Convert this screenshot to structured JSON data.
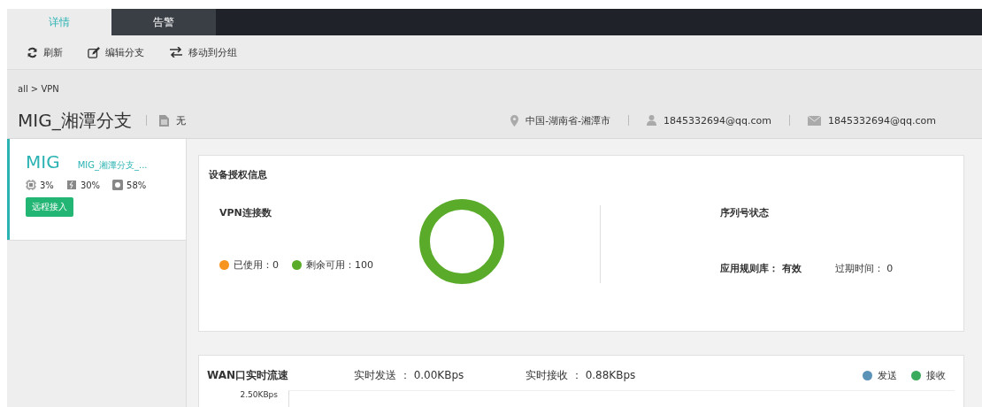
{
  "tabs": [
    {
      "label": "详情",
      "selected": true
    },
    {
      "label": "告警",
      "selected": false
    }
  ],
  "toolbar": [
    {
      "kind": "refresh",
      "label": "刷新"
    },
    {
      "kind": "edit",
      "label": "编辑分支"
    },
    {
      "kind": "move",
      "label": "移动到分组"
    }
  ],
  "breadcrumb": "all > VPN",
  "header": {
    "title": "MIG_湘潭分支",
    "note": "无",
    "location": "中国-湖南省-湘潭市",
    "user": "1845332694@qq.com",
    "email": "1845332694@qq.com"
  },
  "device": {
    "model": "MIG",
    "name": "MIG_湘潭分支_...",
    "stats": [
      {
        "kind": "cpu",
        "value": "3%"
      },
      {
        "kind": "memory",
        "value": "30%"
      },
      {
        "kind": "disk",
        "value": "58%"
      }
    ],
    "button": "远程接入"
  },
  "license": {
    "title": "设备授权信息",
    "vpn_title": "VPN连接数",
    "legend": [
      {
        "label": "已使用：",
        "value": "0",
        "color": "#f7941d"
      },
      {
        "label": "剩余可用：",
        "value": "100",
        "color": "#5aab2a"
      }
    ],
    "serial_title": "序列号状态",
    "rule_label": "应用规则库： 有效",
    "expire_label": "过期时间： 0"
  },
  "traffic": {
    "title": "WAN口实时流速",
    "send": "实时发送 ： 0.00KBps",
    "recv": "实时接收 ： 0.88KBps",
    "legend": [
      {
        "label": "发送",
        "color": "#5b93b8"
      },
      {
        "label": "接收",
        "color": "#3aaa5c"
      }
    ],
    "tick": "2.50KBps"
  }
}
